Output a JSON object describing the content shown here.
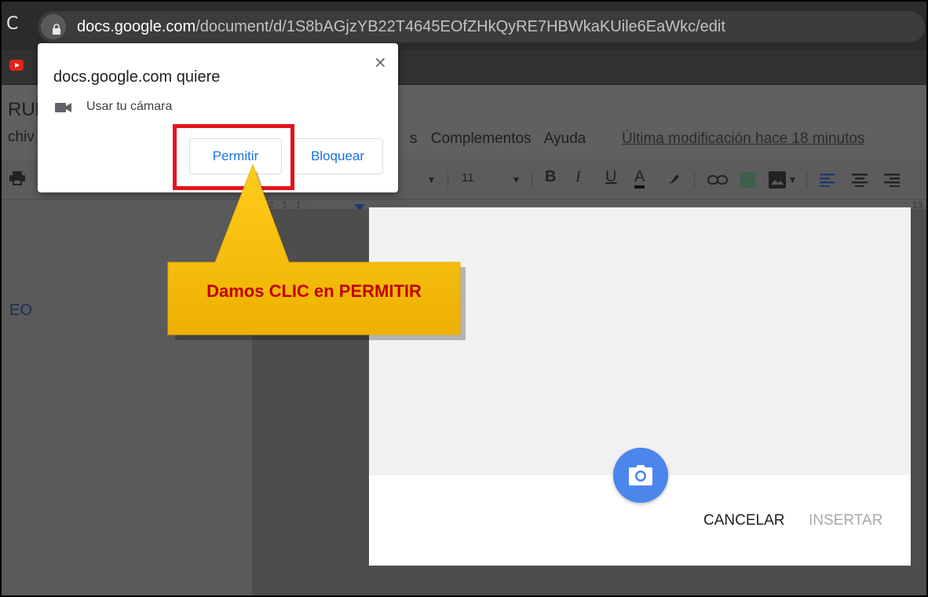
{
  "browser": {
    "url_host": "docs.google.com",
    "url_path": "/document/d/1S8bAGjzYB22T4645EOfZHkQyRE7HBWkaKUile6EaWkc/edit",
    "reload_glyph": "C"
  },
  "docs": {
    "title_fragment": "RUE",
    "menu_fragment": "chiv",
    "menu_items": [
      "s",
      "Complementos",
      "Ayuda"
    ],
    "last_edit": "Última modificación hace 18 minutos",
    "outline_fragment": "EO"
  },
  "toolbar": {
    "font_size": "11",
    "bold": "B",
    "italic": "I",
    "underline": "U",
    "text_color": "A"
  },
  "ruler": {
    "left_text": "2 · 1 · 1 ·",
    "right_text": "13"
  },
  "permission_popup": {
    "title": "docs.google.com quiere",
    "permission": "Usar tu cámara",
    "allow_label": "Permitir",
    "block_label": "Bloquear",
    "close_glyph": "×"
  },
  "camera_dialog": {
    "cancel_label": "CANCELAR",
    "insert_label": "INSERTAR"
  },
  "annotation": {
    "callout_text": "Damos CLIC en PERMITIR",
    "highlight_color": "#e2141b",
    "callout_color": "#f5b800",
    "callout_text_color": "#c00000"
  },
  "icons": {
    "lock": "lock-icon",
    "youtube": "youtube-icon",
    "video": "video-camera-icon",
    "camera": "camera-icon",
    "print": "print-icon"
  }
}
